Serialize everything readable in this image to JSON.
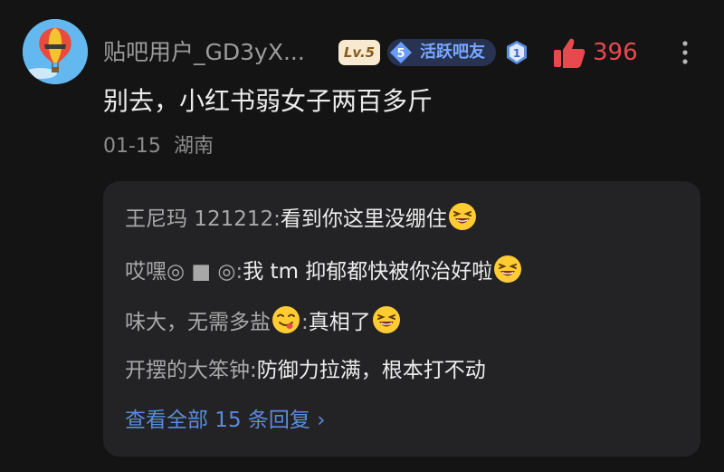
{
  "comment": {
    "username": "贴吧用户_GD3yX...",
    "level_badge": "Lv.5",
    "member_level": "5",
    "member_title": "活跃吧友",
    "rank_number": "1",
    "like_count": "396",
    "text": "别去，小红书弱女子两百多斤",
    "date": "01-15",
    "location": "湖南",
    "icons": [
      "avatar-balloon",
      "rank-badge-icon",
      "thumbs-up-icon",
      "more-vertical-icon"
    ],
    "like_color": "#e8494e"
  },
  "replies": [
    {
      "author": "王尼玛 121212",
      "separator": ":",
      "text": "看到你这里没绷住",
      "emoji": "grinning-squint-emoji"
    },
    {
      "author": "哎嘿◎ ■ ◎",
      "separator": ":",
      "text": "我 tm 抑郁都快被你治好啦",
      "emoji": "grinning-squint-emoji"
    },
    {
      "author": "味大，无需多盐",
      "author_emoji": "savoring-food-emoji",
      "separator": ":",
      "text": "真相了",
      "emoji": "grinning-squint-emoji"
    },
    {
      "author": "开摆的大笨钟",
      "separator": ":",
      "text": "防御力拉满，根本打不动"
    }
  ],
  "view_all": "查看全部 15 条回复 ›"
}
